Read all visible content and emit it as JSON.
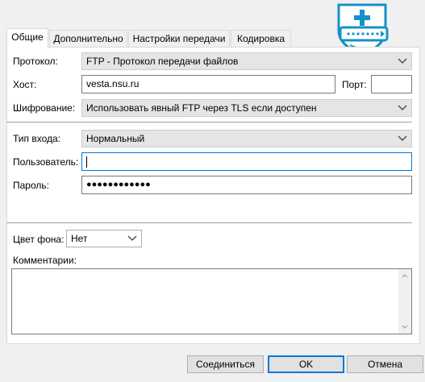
{
  "tabs": [
    {
      "label": "Общие",
      "active": true
    },
    {
      "label": "Дополнительно",
      "active": false
    },
    {
      "label": "Настройки передачи",
      "active": false
    },
    {
      "label": "Кодировка",
      "active": false
    }
  ],
  "form": {
    "protocol_label": "Протокол:",
    "protocol_value": "FTP - Протокол передачи файлов",
    "host_label": "Хост:",
    "host_value": "vesta.nsu.ru",
    "port_label": "Порт:",
    "port_value": "",
    "encryption_label": "Шифрование:",
    "encryption_value": "Использовать явный FTP через TLS если доступен",
    "logon_type_label": "Тип входа:",
    "logon_type_value": "Нормальный",
    "user_label": "Пользователь:",
    "user_value": "",
    "password_label": "Пароль:",
    "password_value": "●●●●●●●●●●●●",
    "bgcolor_label": "Цвет фона:",
    "bgcolor_value": "Нет",
    "comments_label": "Комментарии:",
    "comments_value": ""
  },
  "buttons": {
    "connect": "Соединиться",
    "ok": "OK",
    "cancel": "Отмена"
  },
  "icons": {
    "chevron": "chevron-down-icon",
    "shield": "shield-plus-icon"
  },
  "colors": {
    "shield": "#1591c9",
    "focus": "#0078d7"
  }
}
